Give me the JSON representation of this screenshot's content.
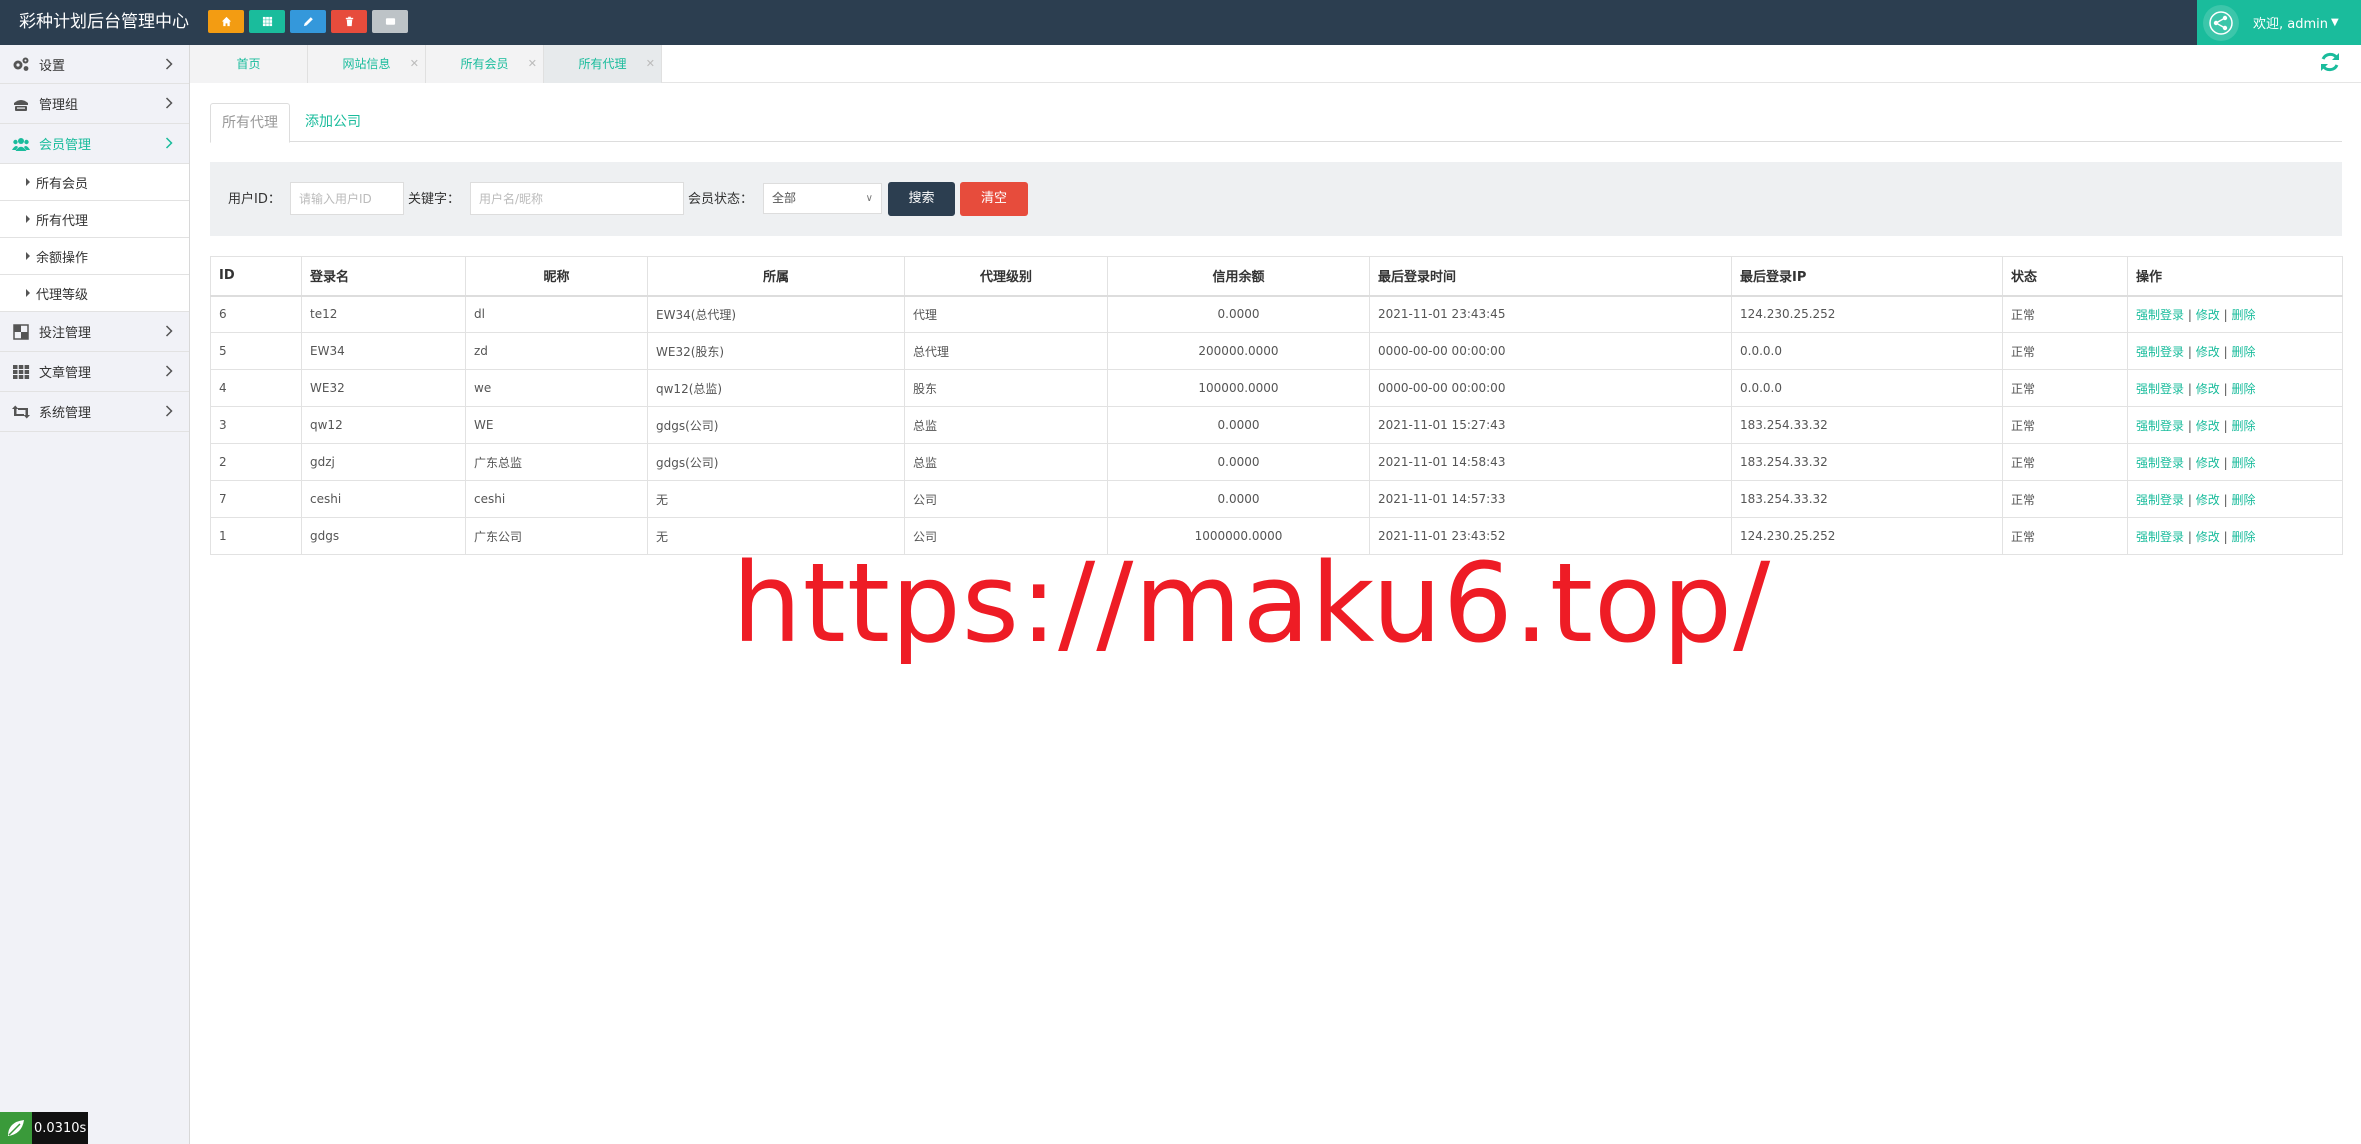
{
  "app": {
    "title": "彩种计划后台管理中心"
  },
  "quick_buttons": [
    {
      "name": "home",
      "color": "#f39c12"
    },
    {
      "name": "grid",
      "color": "#1abc9c"
    },
    {
      "name": "edit",
      "color": "#3498db"
    },
    {
      "name": "delete",
      "color": "#e74c3c"
    },
    {
      "name": "card",
      "color": "#bdc3c7"
    }
  ],
  "user": {
    "greeting": "欢迎, admin"
  },
  "sidebar": {
    "items": [
      {
        "label": "设置",
        "icon": "gears-icon"
      },
      {
        "label": "管理组",
        "icon": "admin-group-icon"
      },
      {
        "label": "会员管理",
        "icon": "users-icon",
        "active": true
      },
      {
        "label": "投注管理",
        "icon": "checkerboard-icon"
      },
      {
        "label": "文章管理",
        "icon": "grid-icon"
      },
      {
        "label": "系统管理",
        "icon": "retweet-icon"
      }
    ],
    "sub_items": [
      "所有会员",
      "所有代理",
      "余额操作",
      "代理等级"
    ]
  },
  "timer": {
    "value": "0.0310s"
  },
  "tabs": [
    {
      "label": "首页"
    },
    {
      "label": "网站信息"
    },
    {
      "label": "所有会员"
    },
    {
      "label": "所有代理"
    }
  ],
  "content_tabs": [
    {
      "label": "所有代理"
    },
    {
      "label": "添加公司"
    }
  ],
  "search": {
    "user_id_label": "用户ID：",
    "user_id_placeholder": "请输入用户ID",
    "keyword_label": "关键字：",
    "keyword_placeholder": "用户名/昵称",
    "status_label": "会员状态：",
    "status_value": "全部",
    "search_button": "搜索",
    "clear_button": "清空"
  },
  "table": {
    "headers": [
      "ID",
      "登录名",
      "昵称",
      "所属",
      "代理级别",
      "信用余额",
      "最后登录时间",
      "最后登录IP",
      "状态",
      "操作"
    ],
    "rows": [
      {
        "id": "6",
        "login": "te12",
        "nick": "dl",
        "parent": "EW34(总代理)",
        "level": "代理",
        "credit": "0.0000",
        "last_time": "2021-11-01 23:43:45",
        "last_ip": "124.230.25.252",
        "status": "正常"
      },
      {
        "id": "5",
        "login": "EW34",
        "nick": "zd",
        "parent": "WE32(股东)",
        "level": "总代理",
        "credit": "200000.0000",
        "last_time": "0000-00-00 00:00:00",
        "last_ip": "0.0.0.0",
        "status": "正常"
      },
      {
        "id": "4",
        "login": "WE32",
        "nick": "we",
        "parent": "qw12(总监)",
        "level": "股东",
        "credit": "100000.0000",
        "last_time": "0000-00-00 00:00:00",
        "last_ip": "0.0.0.0",
        "status": "正常"
      },
      {
        "id": "3",
        "login": "qw12",
        "nick": "WE",
        "parent": "gdgs(公司)",
        "level": "总监",
        "credit": "0.0000",
        "last_time": "2021-11-01 15:27:43",
        "last_ip": "183.254.33.32",
        "status": "正常"
      },
      {
        "id": "2",
        "login": "gdzj",
        "nick": "广东总监",
        "parent": "gdgs(公司)",
        "level": "总监",
        "credit": "0.0000",
        "last_time": "2021-11-01 14:58:43",
        "last_ip": "183.254.33.32",
        "status": "正常"
      },
      {
        "id": "7",
        "login": "ceshi",
        "nick": "ceshi",
        "parent": "无",
        "level": "公司",
        "credit": "0.0000",
        "last_time": "2021-11-01 14:57:33",
        "last_ip": "183.254.33.32",
        "status": "正常"
      },
      {
        "id": "1",
        "login": "gdgs",
        "nick": "广东公司",
        "parent": "无",
        "level": "公司",
        "credit": "1000000.0000",
        "last_time": "2021-11-01 23:43:52",
        "last_ip": "124.230.25.252",
        "status": "正常"
      }
    ],
    "actions": {
      "force_login": "强制登录",
      "edit": "修改",
      "delete": "删除",
      "separator": "|"
    }
  },
  "watermark": {
    "text": "https://maku6.top/"
  },
  "colors": {
    "accent": "#1abc9c",
    "topbar": "#2c3e50",
    "danger": "#e74c3c",
    "watermark": "#ee1c25"
  }
}
